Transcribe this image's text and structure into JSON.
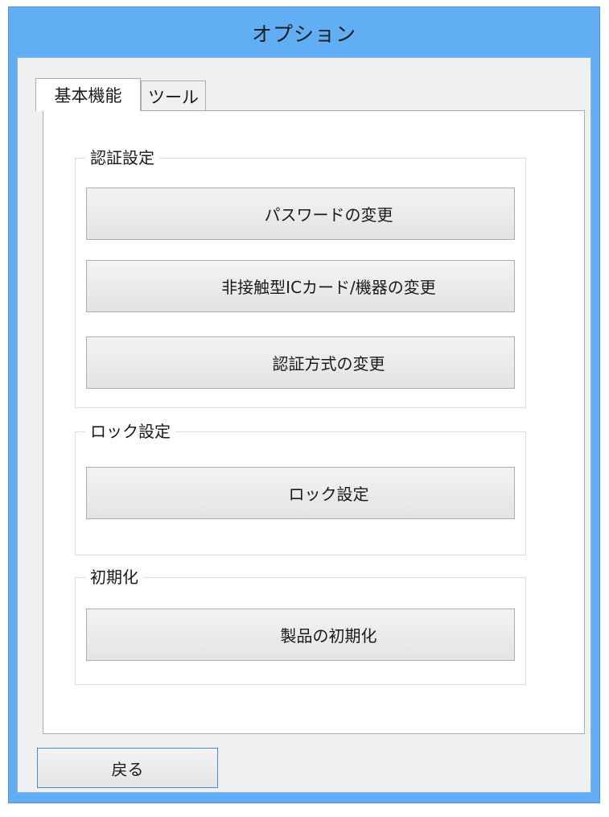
{
  "window": {
    "title": "オプション"
  },
  "tabs": [
    {
      "label": "基本機能",
      "active": true
    },
    {
      "label": "ツール",
      "active": false
    }
  ],
  "groups": {
    "auth": {
      "label": "認証設定",
      "buttons": [
        "パスワードの変更",
        "非接触型ICカード/機器の変更",
        "認証方式の変更"
      ]
    },
    "lock": {
      "label": "ロック設定",
      "buttons": [
        "ロック設定"
      ]
    },
    "init": {
      "label": "初期化",
      "buttons": [
        "製品の初期化"
      ]
    }
  },
  "footer": {
    "back_label": "戻る"
  },
  "colors": {
    "titlebar": "#62aef4",
    "client_bg": "#f0f0f0",
    "focus_border": "#3c8fdc"
  }
}
